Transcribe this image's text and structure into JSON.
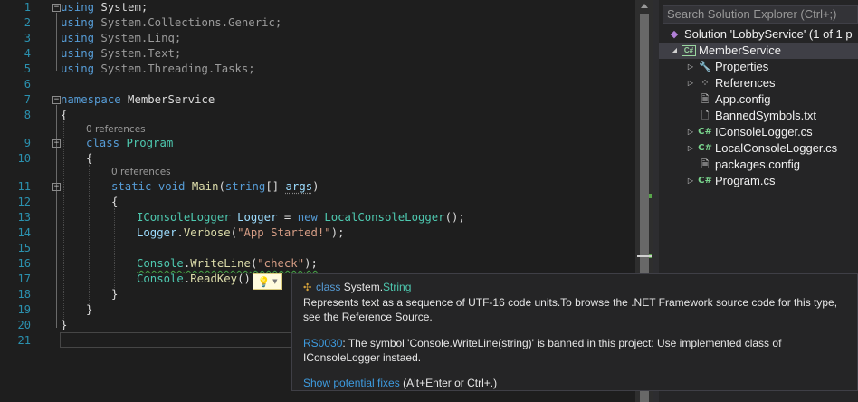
{
  "editor": {
    "line_numbers": [
      "1",
      "2",
      "3",
      "4",
      "5",
      "6",
      "7",
      "8",
      "9",
      "10",
      "11",
      "12",
      "13",
      "14",
      "15",
      "16",
      "17",
      "18",
      "19",
      "20",
      "21"
    ],
    "codelens": {
      "class_refs": "0 references",
      "main_refs": "0 references"
    },
    "code": {
      "l1": {
        "kw": "using",
        "rest": " System;"
      },
      "l2": {
        "kw": "using",
        "rest": " System.Collections.Generic;"
      },
      "l3": {
        "kw": "using",
        "rest": " System.Linq;"
      },
      "l4": {
        "kw": "using",
        "rest": " System.Text;"
      },
      "l5": {
        "kw": "using",
        "rest": " System.Threading.Tasks;"
      },
      "l7": {
        "kw": "namespace",
        "rest": " MemberService"
      },
      "l8": "{",
      "l9": {
        "kw": "class",
        "name": "Program"
      },
      "l10": "{",
      "l11": {
        "kw1": "static",
        "kw2": "void",
        "fn": "Main",
        "p1": "(",
        "kw3": "string",
        "p2": "[] ",
        "arg": "args",
        "p3": ")"
      },
      "l12": "{",
      "l13": {
        "type": "IConsoleLogger",
        "var": "Logger",
        "eq": " = ",
        "kw": "new",
        "ctor": "LocalConsoleLogger",
        "end": "();"
      },
      "l14": {
        "obj": "Logger",
        "dot": ".",
        "fn": "Verbose",
        "p1": "(",
        "str": "\"App Started!\"",
        "end": ");"
      },
      "l16": {
        "obj": "Console",
        "dot": ".",
        "fn": "WriteLine",
        "p1": "(",
        "str": "\"check\"",
        "end": ");"
      },
      "l17": {
        "obj": "Console",
        "dot": ".",
        "fn": "ReadKey",
        "end": "();"
      },
      "l18": "}",
      "l19": "}",
      "l20": "}"
    }
  },
  "tooltip": {
    "kw": "class",
    "type_ns": "System.",
    "type_name": "String",
    "desc_line1": "Represents text as a sequence of UTF-16 code units.To browse the .NET Framework source code for this type,",
    "desc_line2": "see the Reference Source.",
    "diag_code": "RS0030",
    "diag_line1": ": The symbol 'Console.WriteLine(string)' is banned in this project: Use implemented class of",
    "diag_line2": "IConsoleLogger instaed.",
    "fix_link": "Show potential fixes",
    "fix_hint": " (Alt+Enter or Ctrl+.)"
  },
  "explorer": {
    "search_placeholder": "Search Solution Explorer (Ctrl+;)",
    "solution": "Solution 'LobbyService' (1 of 1 p",
    "project": "MemberService",
    "items": [
      {
        "label": "Properties",
        "icon": "wrench-icon",
        "expandable": true
      },
      {
        "label": "References",
        "icon": "references-icon",
        "expandable": true
      },
      {
        "label": "App.config",
        "icon": "config-file-icon",
        "expandable": false
      },
      {
        "label": "BannedSymbols.txt",
        "icon": "text-file-icon",
        "expandable": false
      },
      {
        "label": "IConsoleLogger.cs",
        "icon": "csharp-file-icon",
        "expandable": true
      },
      {
        "label": "LocalConsoleLogger.cs",
        "icon": "csharp-file-icon",
        "expandable": true
      },
      {
        "label": "packages.config",
        "icon": "config-file-icon",
        "expandable": false
      },
      {
        "label": "Program.cs",
        "icon": "csharp-file-icon",
        "expandable": true
      }
    ]
  },
  "colors": {
    "editor_bg": "#1e1e1e",
    "keyword": "#569cd6",
    "type": "#4ec9b0",
    "method": "#dcdcaa",
    "string": "#d69d85",
    "line_number": "#2b91af",
    "link": "#3e9ce0"
  }
}
